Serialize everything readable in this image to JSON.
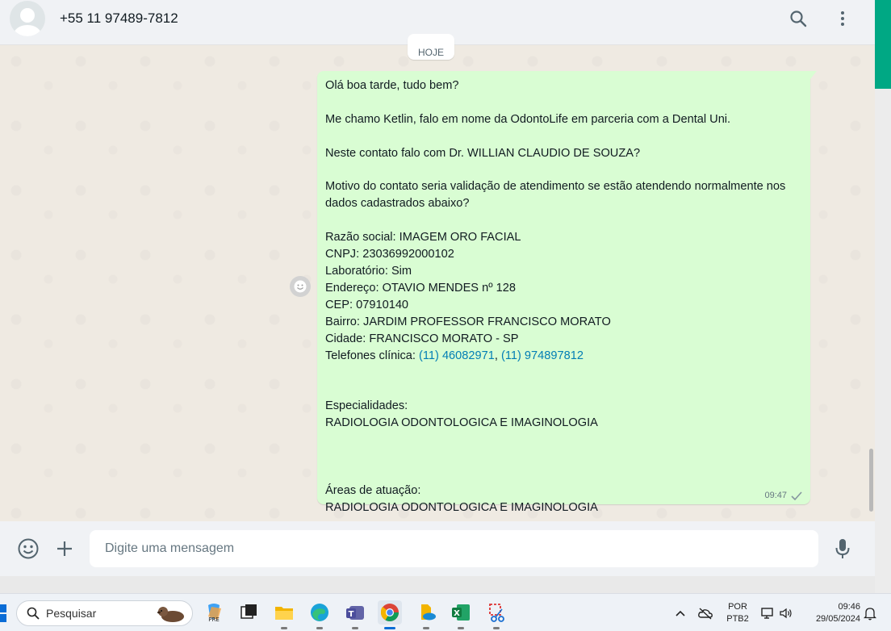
{
  "header": {
    "contact_name": "+55 11 97489-7812",
    "icons": [
      "search-icon",
      "menu-icon"
    ]
  },
  "chat": {
    "date_chip": "HOJE",
    "message": {
      "text_main": "Olá boa tarde, tudo bem?\n\nMe chamo Ketlin, falo em nome da OdontoLife em parceria com a Dental Uni.\n\nNeste contato falo com Dr. WILLIAN CLAUDIO DE SOUZA?\n\nMotivo do contato seria validação de atendimento se estão atendendo normalmente nos dados cadastrados abaixo?\n\nRazão social: IMAGEM ORO FACIAL\nCNPJ: 23036992000102\nLaboratório: Sim\nEndereço: OTAVIO MENDES nº 128\nCEP: 07910140\nBairro: JARDIM PROFESSOR FRANCISCO MORATO\nCidade: FRANCISCO MORATO - SP\n",
      "phones_label": "Telefones clínica: ",
      "phone_1": "(11) 46082971",
      "phone_sep": ", ",
      "phone_2": "(11) 974897812",
      "text_tail": "\n\n\nEspecialidades:\nRADIOLOGIA ODONTOLOGICA E IMAGINOLOGIA\n\n\n\nÁreas de atuação:\nRADIOLOGIA ODONTOLOGICA E IMAGINOLOGIA",
      "time": "09:47"
    }
  },
  "composer": {
    "placeholder": "Digite uma mensagem"
  },
  "taskbar": {
    "search_label": "Pesquisar",
    "language_top": "POR",
    "language_bottom": "PTB2",
    "time": "09:46",
    "date": "29/05/2024"
  },
  "colors": {
    "bubble": "#d9fdd3",
    "chat_bg": "#efeae2",
    "link": "#027eb5",
    "accent": "#00a884"
  }
}
